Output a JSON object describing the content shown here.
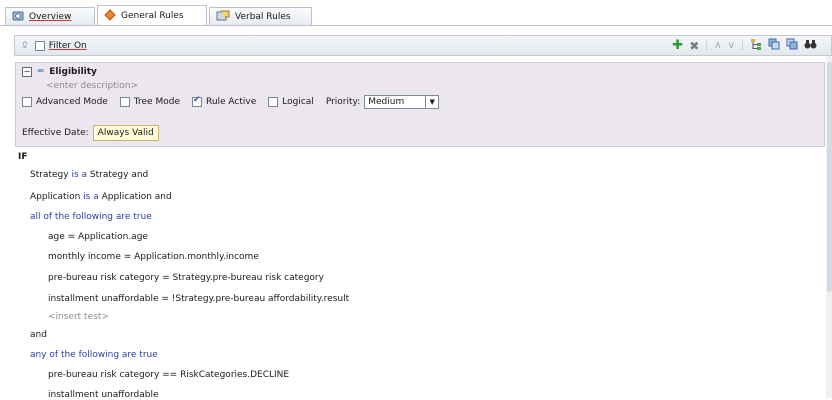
{
  "tabs": {
    "overview": "Overview",
    "general_rules": "General Rules",
    "verbal_rules": "Verbal Rules"
  },
  "filter": {
    "label": "Filter On"
  },
  "rule": {
    "name": "Eligibility",
    "description_placeholder": "<enter description>",
    "advanced_mode": "Advanced Mode",
    "tree_mode": "Tree Mode",
    "rule_active": "Rule Active",
    "logical": "Logical",
    "priority_label": "Priority:",
    "priority_value": "Medium",
    "effective_date_label": "Effective Date:",
    "effective_date_value": "Always Valid"
  },
  "body": {
    "if": "IF",
    "l1_a": "Strategy",
    "l1_b": "is a",
    "l1_c": "Strategy and",
    "l2_a": "Application",
    "l2_b": "is a",
    "l2_c": "Application and",
    "all_true": "all of the following are true",
    "t1": "age = Application.age",
    "t2": "monthly income = Application.monthly.income",
    "t3": "pre-bureau risk category = Strategy.pre-bureau risk category",
    "t4": "installment unaffordable = !Strategy.pre-bureau affordability.result",
    "insert_test": "<insert test>",
    "and": "and",
    "any_true": "any of the following are true",
    "a1": "pre-bureau risk category  ==  RiskCategories.DECLINE",
    "a2": "installment unaffordable"
  },
  "colors": {
    "keyword": "#2b3fa8",
    "rule_bg": "#ece6ef",
    "date_bg": "#fffbd8"
  }
}
